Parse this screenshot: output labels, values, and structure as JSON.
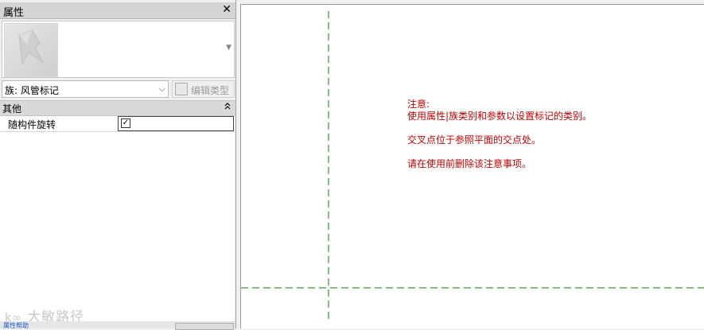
{
  "properties": {
    "title": "属性",
    "close_glyph": "✕",
    "family_label": "族: 风管标记",
    "edit_type_label": "编辑类型",
    "group_name": "其他",
    "group_collapse_glyph": "⌃",
    "parameter": {
      "name": "随构件旋转",
      "checked": true
    },
    "footer_link": "属性帮助",
    "watermark": "大敏路径"
  },
  "canvas": {
    "note_title": "注意:",
    "note_line1": "使用属性|族类别和参数以设置标记的类别。",
    "note_line2": "交叉点位于参照平面的交点处。",
    "note_line3": "请在使用前删除该注意事项。",
    "note_color": "#c00000",
    "reference_plane_color": "#008000"
  }
}
